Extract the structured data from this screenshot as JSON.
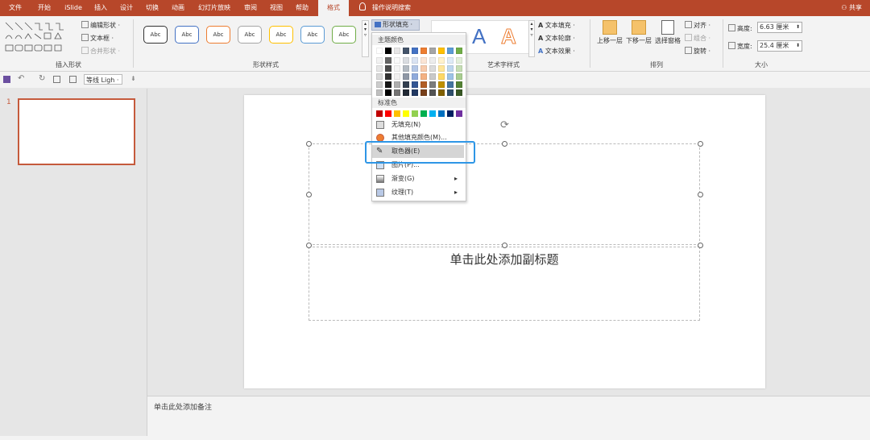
{
  "tabs": [
    "文件",
    "开始",
    "iSlide",
    "插入",
    "设计",
    "切换",
    "动画",
    "幻灯片放映",
    "审阅",
    "视图",
    "帮助",
    "格式"
  ],
  "active_tab": "格式",
  "tell_me": "操作说明搜索",
  "share": "共享",
  "ribbon": {
    "insert_shapes": {
      "edit_shape": "编辑形状 ·",
      "text_box": "文本框 ·",
      "merge_shapes": "合并形状 ·",
      "label": "插入形状"
    },
    "shape_styles": {
      "sample": "Abc",
      "label": "形状样式",
      "fill_button": "形状填充 ·",
      "colors": [
        "#333333",
        "#4472c4",
        "#ed7d31",
        "#a5a5a5",
        "#ffc000",
        "#5b9bd5",
        "#70ad47"
      ]
    },
    "wordart": {
      "text_fill": "文本填充 ·",
      "text_outline": "文本轮廓 ·",
      "text_effect": "文本效果 ·",
      "label": "艺术字样式",
      "glyph": "A"
    },
    "arrange": {
      "bring_forward": "上移一层",
      "send_backward": "下移一层",
      "selection_pane": "选择窗格",
      "align": "对齐 ·",
      "group": "组合 ·",
      "rotate": "旋转 ·",
      "label": "排列"
    },
    "size": {
      "height_label": "高度:",
      "height_value": "6.63 厘米",
      "width_label": "宽度:",
      "width_value": "25.4 厘米",
      "label": "大小"
    }
  },
  "qat": {
    "font": "等线 Ligh ·"
  },
  "slide_number": "1",
  "slide": {
    "subtitle_placeholder": "单击此处添加副标题"
  },
  "notes_placeholder": "单击此处添加备注",
  "fill_menu": {
    "theme_colors_header": "主题颜色",
    "standard_colors_header": "标准色",
    "theme_top": [
      "#ffffff",
      "#000000",
      "#e7e6e6",
      "#44546a",
      "#4472c4",
      "#ed7d31",
      "#a5a5a5",
      "#ffc000",
      "#5b9bd5",
      "#70ad47"
    ],
    "standard": [
      "#c00000",
      "#ff0000",
      "#ffc000",
      "#ffff00",
      "#92d050",
      "#00b050",
      "#00b0f0",
      "#0070c0",
      "#002060",
      "#7030a0"
    ],
    "no_fill": "无填充(N)",
    "more_colors": "其他填充颜色(M)...",
    "eyedropper": "取色器(E)",
    "picture": "图片(P)...",
    "gradient": "渐变(G)",
    "texture": "纹理(T)"
  }
}
